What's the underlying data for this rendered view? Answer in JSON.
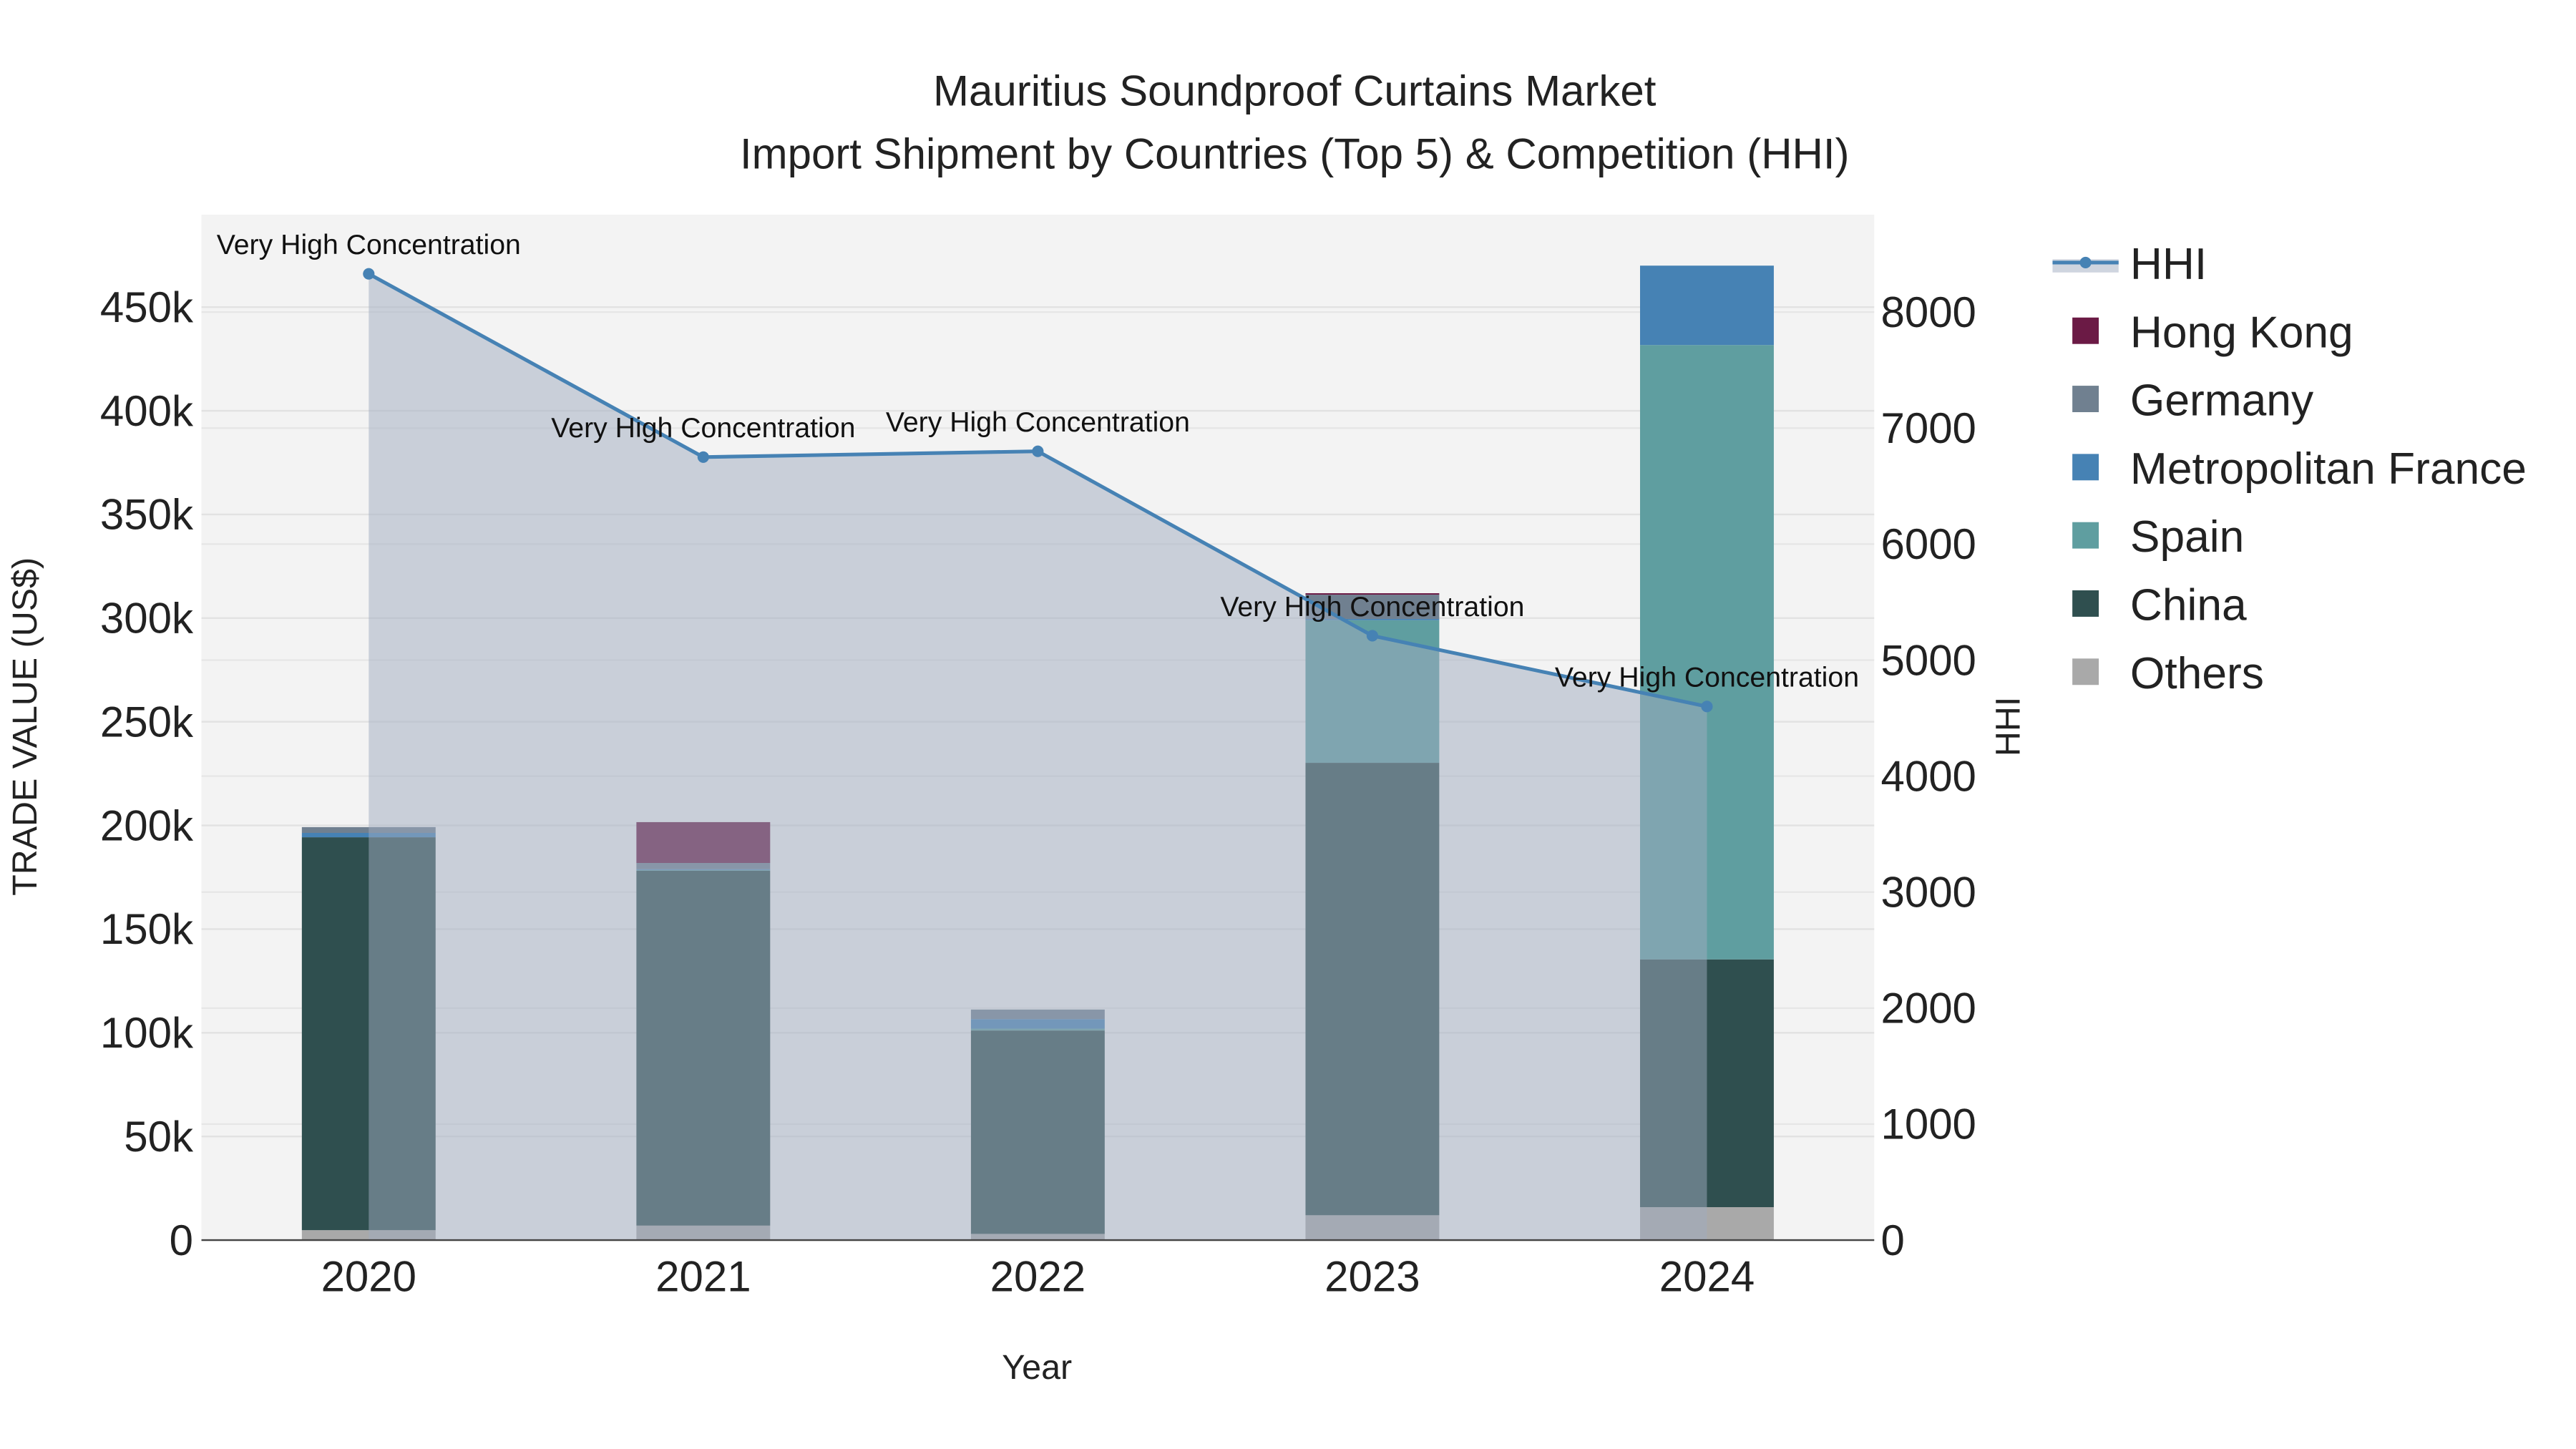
{
  "chart_data": {
    "type": "bar",
    "title": "Mauritius Soundproof Curtains Market",
    "subtitle": "Import Shipment by Countries (Top 5) & Competition (HHI)",
    "xlabel": "Year",
    "ylabel": "TRADE VALUE (US$)",
    "y2label": "HHI",
    "categories": [
      "2020",
      "2021",
      "2022",
      "2023",
      "2024"
    ],
    "ylim": [
      0,
      490000
    ],
    "y2lim": [
      0,
      8800
    ],
    "yticks": [
      0,
      50000,
      100000,
      150000,
      200000,
      250000,
      300000,
      350000,
      400000,
      450000
    ],
    "ytick_labels": [
      "0",
      "50k",
      "100k",
      "150k",
      "200k",
      "250k",
      "300k",
      "350k",
      "400k",
      "450k"
    ],
    "y2ticks": [
      0,
      1000,
      2000,
      3000,
      4000,
      5000,
      6000,
      7000,
      8000
    ],
    "y2tick_labels": [
      "0",
      "1000",
      "2000",
      "3000",
      "4000",
      "5000",
      "6000",
      "7000",
      "8000"
    ],
    "stacked": true,
    "series": [
      {
        "name": "Others",
        "color": "#a9a9a9",
        "values": [
          4800,
          7000,
          3000,
          12000,
          15900
        ]
      },
      {
        "name": "China",
        "color": "#2f4f4f",
        "values": [
          189500,
          171200,
          98100,
          218200,
          119500
        ]
      },
      {
        "name": "Spain",
        "color": "#5f9ea0",
        "values": [
          0,
          300,
          900,
          68800,
          296300
        ]
      },
      {
        "name": "Metropolitan France",
        "color": "#4682b4",
        "values": [
          2100,
          400,
          4600,
          600,
          38300
        ]
      },
      {
        "name": "Germany",
        "color": "#708090",
        "values": [
          2800,
          3000,
          4600,
          11700,
          0
        ]
      },
      {
        "name": "Hong Kong",
        "color": "#6b1a45",
        "values": [
          0,
          19700,
          0,
          700,
          0
        ]
      }
    ],
    "hhi": {
      "name": "HHI",
      "color": "#4682b4",
      "values": [
        8330,
        6750,
        6800,
        5210,
        4600
      ],
      "annotations": [
        "Very High Concentration",
        "Very High Concentration",
        "Very High Concentration",
        "Very High Concentration",
        "Very High Concentration"
      ]
    },
    "legend": [
      "HHI",
      "Hong Kong",
      "Germany",
      "Metropolitan France",
      "Spain",
      "China",
      "Others"
    ],
    "legend_position": "right",
    "grid": true
  }
}
